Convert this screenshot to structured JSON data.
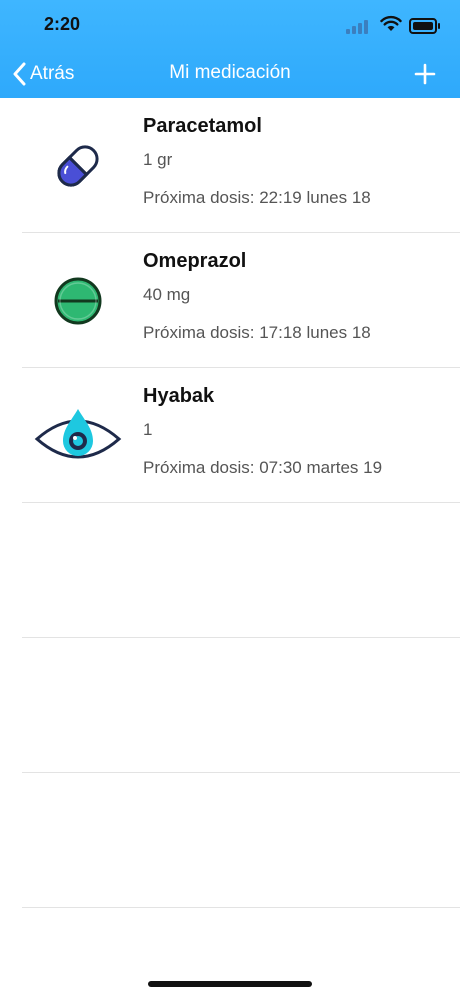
{
  "status_bar": {
    "time": "2:20"
  },
  "nav": {
    "back_label": "Atrás",
    "title": "Mi medicación"
  },
  "medications": [
    {
      "name": "Paracetamol",
      "dose": "1 gr",
      "next_dose": "Próxima dosis: 22:19 lunes 18",
      "icon": "capsule-icon"
    },
    {
      "name": "Omeprazol",
      "dose": "40 mg",
      "next_dose": "Próxima dosis: 17:18 lunes 18",
      "icon": "tablet-icon"
    },
    {
      "name": "Hyabak",
      "dose": "1",
      "next_dose": "Próxima dosis: 07:30 martes 19",
      "icon": "eye-drop-icon"
    }
  ],
  "colors": {
    "accent": "#2ea9fb",
    "capsule": "#4a4fd6",
    "tablet": "#2eb872",
    "eye_drop": "#1ec8e0"
  }
}
